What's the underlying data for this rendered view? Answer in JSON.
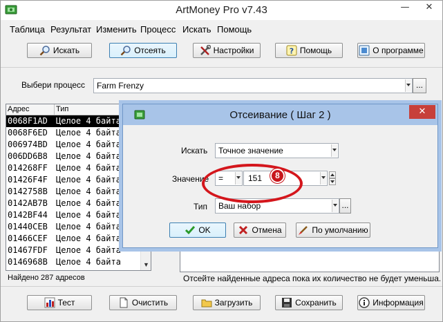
{
  "window": {
    "title": "ArtMoney Pro v7.43",
    "minimize": "—",
    "close": "✕"
  },
  "menu": [
    "Таблица",
    "Результат",
    "Изменить",
    "Процесс",
    "Искать",
    "Помощь"
  ],
  "toolbar": {
    "search": "Искать",
    "filter": "Отсеять",
    "settings": "Настройки",
    "help": "Помощь",
    "about": "О программе"
  },
  "process": {
    "label": "Выбери процесс",
    "value": "Farm Frenzy",
    "browse": "..."
  },
  "list": {
    "columns": [
      "Адрес",
      "Тип"
    ],
    "rows": [
      [
        "0068F1AD",
        "Целое 4 байта"
      ],
      [
        "0068F6ED",
        "Целое 4 байта"
      ],
      [
        "006974BD",
        "Целое 4 байта"
      ],
      [
        "006DD6B8",
        "Целое 4 байта"
      ],
      [
        "014268FF",
        "Целое 4 байта"
      ],
      [
        "01426F4F",
        "Целое 4 байта"
      ],
      [
        "0142758B",
        "Целое 4 байта"
      ],
      [
        "0142AB7B",
        "Целое 4 байта"
      ],
      [
        "0142BF44",
        "Целое 4 байта"
      ],
      [
        "01440CEB",
        "Целое 4 байта"
      ],
      [
        "01466CEF",
        "Целое 4 байта"
      ],
      [
        "01467FDF",
        "Целое 4 байта"
      ],
      [
        "0146968B",
        "Целое 4 байта"
      ]
    ],
    "scroll_down": "▼"
  },
  "status": {
    "found": "Найдено 287 адресов",
    "hint": "Отсейте найденные адреса пока их количество не будет уменьша..."
  },
  "bottom": {
    "test": "Тест",
    "clear": "Очистить",
    "load": "Загрузить",
    "save": "Сохранить",
    "info": "Информация"
  },
  "dialog": {
    "title": "Отсеивание ( Шаг 2 )",
    "close": "✕",
    "search_label": "Искать",
    "search_value": "Точное значение",
    "value_label": "Значение",
    "operator": "=",
    "value": "151",
    "type_label": "Тип",
    "type_value": "Ваш набор",
    "browse": "...",
    "ok": "OK",
    "cancel": "Отмена",
    "default": "По умолчанию"
  },
  "annotation": {
    "badge": "8"
  },
  "colors": {
    "dialog_frame": "#a8c4e8",
    "close_red": "#c7403a",
    "annotation_red": "#d4161c",
    "selection": "#000000"
  }
}
